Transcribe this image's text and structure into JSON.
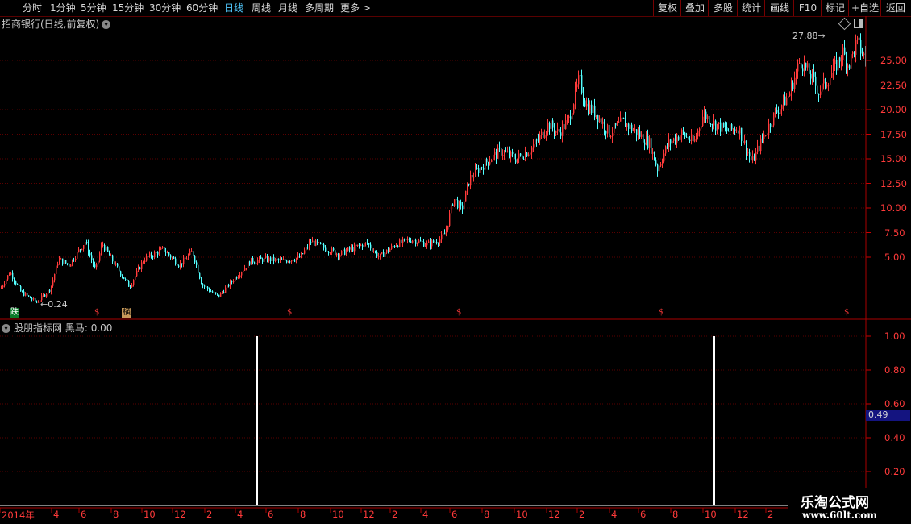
{
  "toolbar": {
    "periods": [
      {
        "label": "分时",
        "active": false
      },
      {
        "label": "1分钟",
        "active": false
      },
      {
        "label": "5分钟",
        "active": false
      },
      {
        "label": "15分钟",
        "active": false
      },
      {
        "label": "30分钟",
        "active": false
      },
      {
        "label": "60分钟",
        "active": false
      },
      {
        "label": "日线",
        "active": true
      },
      {
        "label": "周线",
        "active": false
      },
      {
        "label": "月线",
        "active": false
      },
      {
        "label": "多周期",
        "active": false
      }
    ],
    "more_label": "更多 >",
    "right_buttons": [
      "复权",
      "叠加",
      "多股",
      "统计",
      "画线",
      "F10",
      "标记",
      "+自选",
      "返回"
    ]
  },
  "main_chart": {
    "title": "招商银行(日线,前复权)",
    "y_ticks": [
      "25.00",
      "22.50",
      "20.00",
      "17.50",
      "15.00",
      "12.50",
      "10.00",
      "7.50",
      "5.00"
    ],
    "high_marker": "27.88",
    "low_marker": "0.24",
    "signal_labels": [
      {
        "text": "跌",
        "kind": "green"
      },
      {
        "text": "$",
        "kind": "red"
      },
      {
        "text": "横",
        "kind": "tan"
      },
      {
        "text": "$",
        "kind": "red"
      },
      {
        "text": "$",
        "kind": "red"
      },
      {
        "text": "$",
        "kind": "red"
      },
      {
        "text": "$",
        "kind": "red"
      }
    ],
    "colors": {
      "up": "#ff3b3b",
      "down": "#54ffff",
      "grid": "#5a0000",
      "axis_text": "#ff3a3a"
    }
  },
  "indicator": {
    "dropdown_label": "股朋指标网",
    "name_value": "黑马: 0.00",
    "y_ticks": [
      "1.00",
      "0.80",
      "0.60",
      "0.40",
      "0.20"
    ],
    "current_value": "0.49",
    "chart_data": {
      "type": "bar",
      "series": [
        {
          "values": [
            1.0,
            1.0
          ]
        }
      ],
      "ylim": [
        0,
        1.05
      ]
    }
  },
  "x_axis": {
    "labels": [
      "2014年",
      "4",
      "6",
      "8",
      "10",
      "12",
      "2",
      "4",
      "6",
      "8",
      "10",
      "12",
      "2",
      "4",
      "6",
      "8",
      "10",
      "12",
      "2",
      "4",
      "6",
      "8",
      "10",
      "12",
      "2"
    ]
  },
  "watermark": {
    "line1": "乐淘公式网",
    "line2": "www.60lt.com"
  }
}
